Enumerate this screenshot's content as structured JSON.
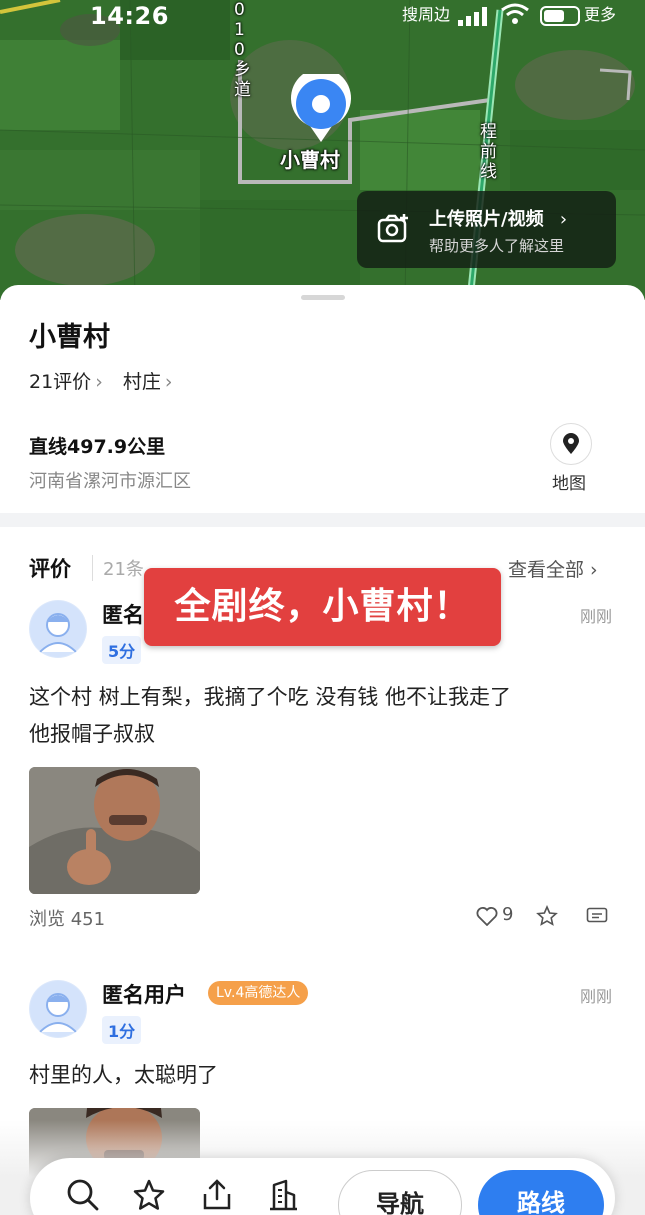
{
  "status_bar": {
    "time": "14:26",
    "left_label": "搜周边",
    "right_label": "更多"
  },
  "map": {
    "road_label_left": "010乡道",
    "road_label_right": "程前线",
    "village_name": "小曹村",
    "upload_card": {
      "title": "上传照片/视频",
      "subtitle": "帮助更多人了解这里",
      "chevron": "›"
    }
  },
  "place": {
    "name": "小曹村",
    "review_count_label": "21评价",
    "category_label": "村庄",
    "chevron": "›",
    "distance": "直线497.9公里",
    "address": "河南省漯河市源汇区",
    "map_button_label": "地图"
  },
  "reviews_section": {
    "title": "评价",
    "count": "21条",
    "see_all": "查看全部 ›"
  },
  "overlay_banner": "全剧终，小曹村！",
  "reviews": [
    {
      "user": "匿名",
      "score": "5分",
      "time": "刚刚",
      "text_line1": "这个村 树上有梨，我摘了个吃 没有钱 他不让我走了",
      "text_line2": "他报帽子叔叔",
      "views": "浏览 451",
      "likes": "9"
    },
    {
      "user": "匿名用户",
      "level": "Lv.4高德达人",
      "score": "1分",
      "time": "刚刚",
      "text_line1": "村里的人，太聪明了"
    }
  ],
  "bottom_bar": {
    "nav_label": "导航",
    "route_label": "路线"
  },
  "colors": {
    "accent": "#2e7ef0",
    "banner": "#e2403f",
    "level_badge": "#f5a04a"
  }
}
